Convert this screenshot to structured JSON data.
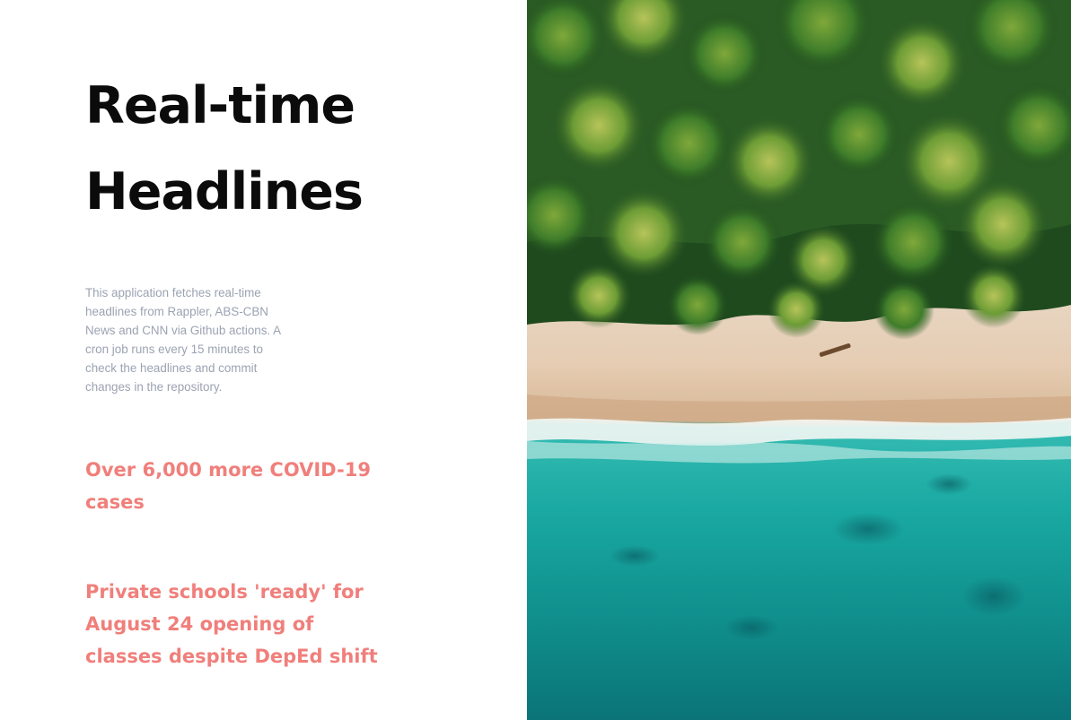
{
  "hero": {
    "title_line1": "Real-time",
    "title_line2": "Headlines",
    "description": "This application fetches real-time headlines from Rappler, ABS-CBN News and CNN via Github actions. A cron job runs every 15 minutes to check the headlines and commit changes in the repository."
  },
  "headlines": [
    {
      "text": "Over 6,000 more COVID-19 cases"
    },
    {
      "text": "Private schools 'ready' for August 24 opening of classes despite DepEd shift"
    }
  ],
  "image": {
    "subject": "aerial-beach-photo"
  },
  "colors": {
    "title": "#0b0b0b",
    "description": "#9ba3b2",
    "headline": "#f07f7b"
  }
}
